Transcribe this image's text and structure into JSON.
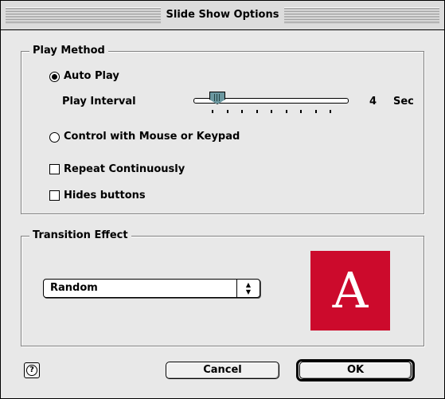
{
  "window": {
    "title": "Slide Show Options"
  },
  "play_method": {
    "title": "Play Method",
    "auto_play": {
      "label": "Auto Play",
      "selected": true
    },
    "interval": {
      "label": "Play Interval",
      "value": "4",
      "unit": "Sec",
      "slider_fraction": 0.125
    },
    "control": {
      "label": "Control with Mouse or Keypad",
      "selected": false
    },
    "repeat": {
      "label": "Repeat Continuously",
      "checked": false
    },
    "hides": {
      "label": "Hides buttons",
      "checked": false
    }
  },
  "transition": {
    "title": "Transition Effect",
    "popup_value": "Random",
    "preview_letter": "A",
    "preview_color": "#cc0a2c"
  },
  "buttons": {
    "cancel": "Cancel",
    "ok": "OK",
    "help": "?"
  }
}
